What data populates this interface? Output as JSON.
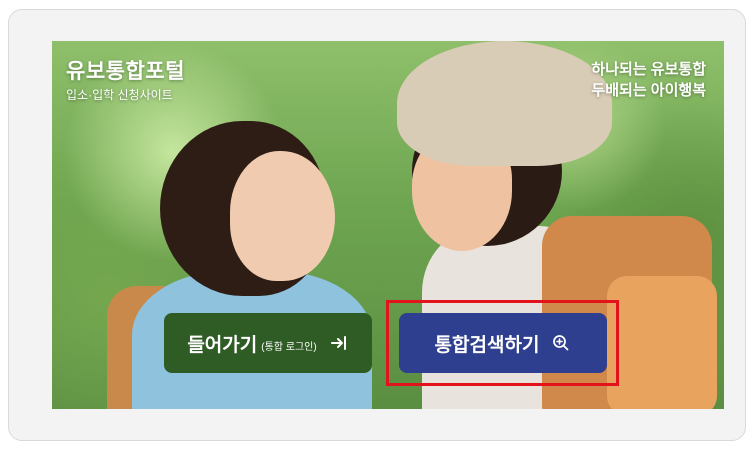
{
  "brand": {
    "title": "유보통합포털",
    "subtitle": "입소·입학 신청사이트"
  },
  "slogan": {
    "line1": "하나되는 유보통합",
    "line2": "두배되는 아이행복"
  },
  "buttons": {
    "enter": {
      "label": "들어가기",
      "note": "(통합 로그인)",
      "icon": "login-arrow-icon"
    },
    "search": {
      "label": "통합검색하기",
      "icon": "zoom-in-icon"
    }
  },
  "colors": {
    "enter_button": "#2f5b25",
    "search_button": "#2f3f8f",
    "highlight": "#e2131b"
  }
}
